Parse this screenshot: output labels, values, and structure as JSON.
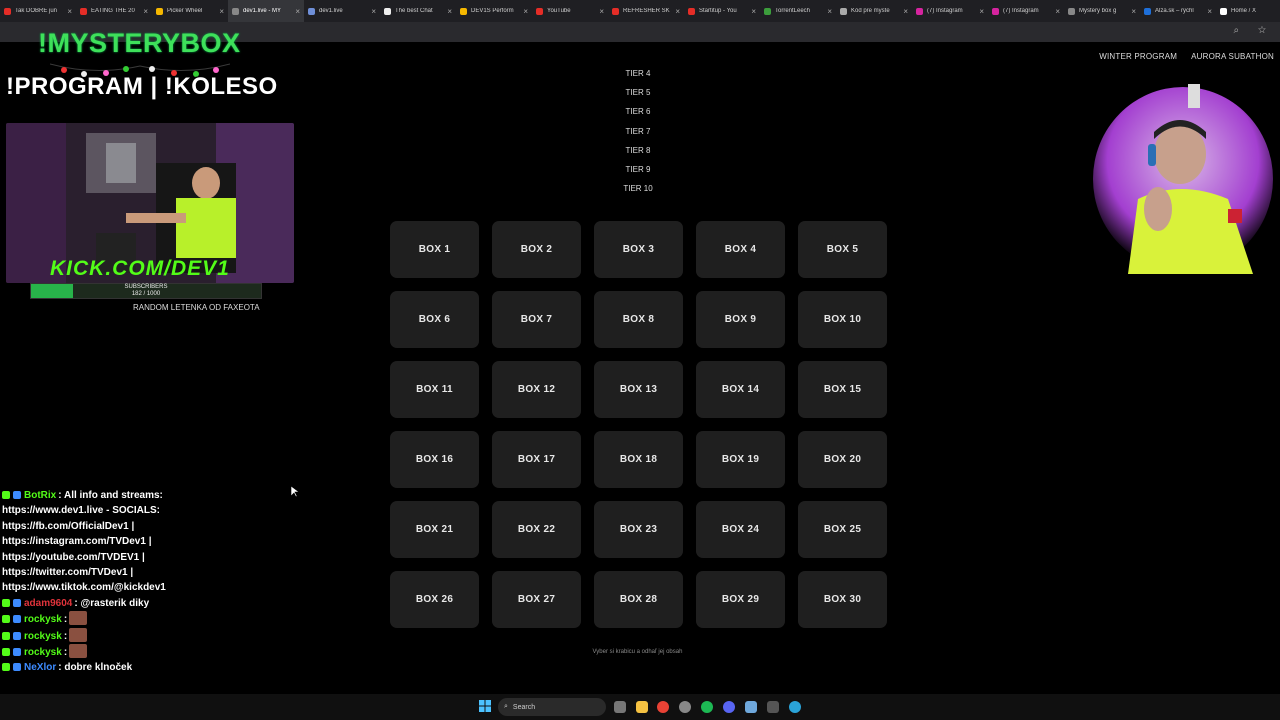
{
  "browser": {
    "tabs": [
      {
        "label": "Tak DOBRÉ jun",
        "color": "#e52d27",
        "active": false
      },
      {
        "label": "EATING THE 20",
        "color": "#e52d27",
        "active": false
      },
      {
        "label": "Picker Wheel",
        "color": "#f6b800",
        "active": false
      },
      {
        "label": "dev1.live - MY",
        "color": "#888888",
        "active": true
      },
      {
        "label": "dev1.live",
        "color": "#6f8fd8",
        "active": false
      },
      {
        "label": "The best Chat",
        "color": "#eeeeee",
        "active": false
      },
      {
        "label": "DEV1S Perform",
        "color": "#f6b800",
        "active": false
      },
      {
        "label": "YouTube",
        "color": "#e52d27",
        "active": false
      },
      {
        "label": "REFRESHER SK",
        "color": "#e52d27",
        "active": false
      },
      {
        "label": "Startitup - You",
        "color": "#e52d27",
        "active": false
      },
      {
        "label": "TorrentLeech",
        "color": "#3c9d3c",
        "active": false
      },
      {
        "label": "Kód pre myste",
        "color": "#aaaaaa",
        "active": false
      },
      {
        "label": "(7) Instagram",
        "color": "#d6249f",
        "active": false
      },
      {
        "label": "(7) Instagram",
        "color": "#d6249f",
        "active": false
      },
      {
        "label": "Mystery box g",
        "color": "#888888",
        "active": false
      },
      {
        "label": "Alza.sk – rýchl",
        "color": "#1e6fd9",
        "active": false
      },
      {
        "label": "Home / X",
        "color": "#ffffff",
        "active": false
      }
    ]
  },
  "topnav": {
    "winter_program": "WINTER PROGRAM",
    "aurora_subathon": "AURORA SUBATHON"
  },
  "tiers": [
    "TIER 4",
    "TIER 5",
    "TIER 6",
    "TIER 7",
    "TIER 8",
    "TIER 9",
    "TIER 10"
  ],
  "boxes": [
    "BOX 1",
    "BOX 2",
    "BOX 3",
    "BOX 4",
    "BOX 5",
    "BOX 6",
    "BOX 7",
    "BOX 8",
    "BOX 9",
    "BOX 10",
    "BOX 11",
    "BOX 12",
    "BOX 13",
    "BOX 14",
    "BOX 15",
    "BOX 16",
    "BOX 17",
    "BOX 18",
    "BOX 19",
    "BOX 20",
    "BOX 21",
    "BOX 22",
    "BOX 23",
    "BOX 24",
    "BOX 25",
    "BOX 26",
    "BOX 27",
    "BOX 28",
    "BOX 29",
    "BOX 30"
  ],
  "hint": "Vyber si krabicu a odhaľ jej obsah",
  "overlay": {
    "title": "!MYSTERYBOX",
    "commands": "!PROGRAM | !KOLESO",
    "kick": "KICK.COM/DEV1",
    "subscribers_label": "SUBSCRIBERS",
    "subscribers_count": "182 / 1000",
    "subscribers_progress": 0.182,
    "random": "RANDOM LETENKA OD FAXEOTA"
  },
  "chat": [
    {
      "user": "BotRix",
      "user_color": "#53fc18",
      "text": ": All info and streams:"
    },
    {
      "user": "",
      "user_color": "#ffffff",
      "text": "https://www.dev1.live - SOCIALS:"
    },
    {
      "user": "",
      "user_color": "#ffffff",
      "text": "https://fb.com/OfficialDev1 |"
    },
    {
      "user": "",
      "user_color": "#ffffff",
      "text": "https://instagram.com/TVDev1 |"
    },
    {
      "user": "",
      "user_color": "#ffffff",
      "text": "https://youtube.com/TVDEV1 |"
    },
    {
      "user": "",
      "user_color": "#ffffff",
      "text": "https://twitter.com/TVDev1 |"
    },
    {
      "user": "",
      "user_color": "#ffffff",
      "text": "https://www.tiktok.com/@kickdev1"
    },
    {
      "user": "adam9604",
      "user_color": "#e0333b",
      "text": ": @rasterik diky"
    },
    {
      "user": "rockysk",
      "user_color": "#53fc18",
      "text": ":"
    },
    {
      "user": "rockysk",
      "user_color": "#53fc18",
      "text": ":"
    },
    {
      "user": "rockysk",
      "user_color": "#53fc18",
      "text": ":"
    },
    {
      "user": "NeXlor",
      "user_color": "#3d8bff",
      "text": ": dobre klnoček"
    }
  ],
  "taskbar": {
    "search_placeholder": "Search"
  }
}
